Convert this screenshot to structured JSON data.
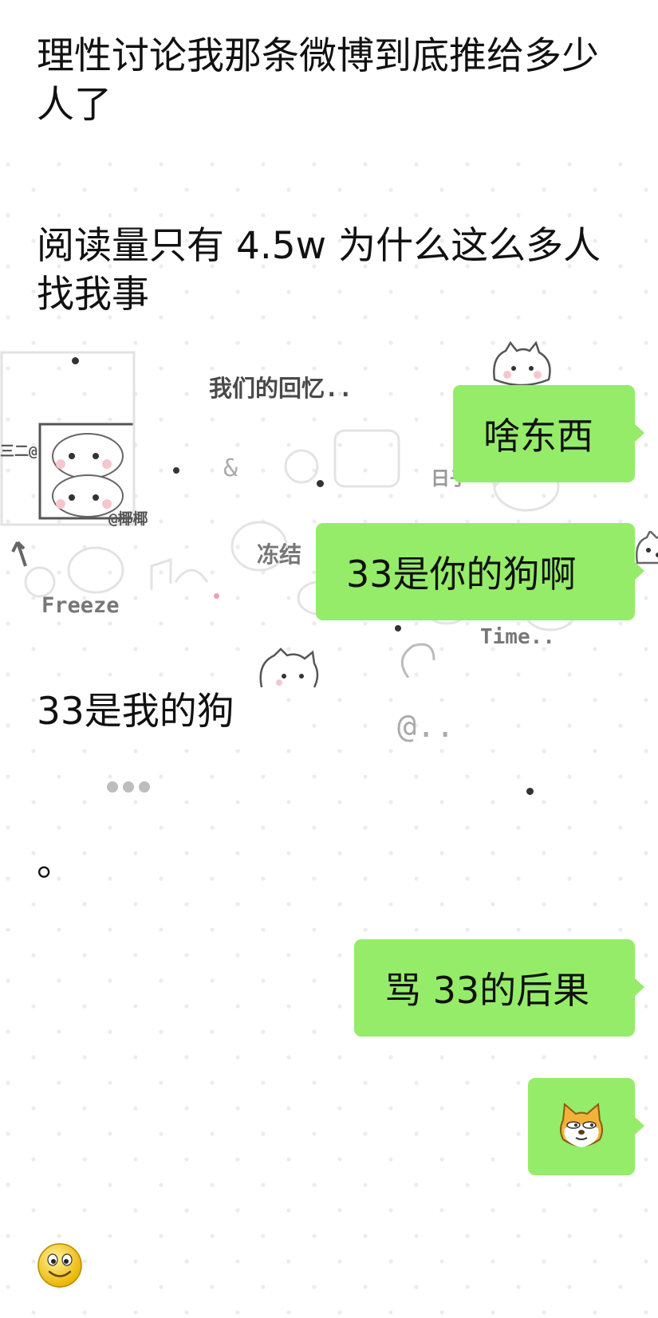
{
  "messages_left": [
    {
      "text": "理性讨论我那条微博到底推给多少人了"
    },
    {
      "text": "阅读量只有 4.5w 为什么这么多人找我事"
    },
    {
      "text": "33是我的狗"
    },
    {
      "text": "。"
    }
  ],
  "messages_right": [
    {
      "text": "啥东西"
    },
    {
      "text": "33是你的狗啊"
    },
    {
      "text": "骂 33的后果"
    },
    {
      "text": "",
      "sticker": "doge-cat-icon"
    }
  ],
  "last_left_sticker": "smiley-face-icon",
  "wallpaper": {
    "texts": [
      "我们的回忆..",
      "@椰椰",
      "三二@",
      "冻结",
      "Freeze",
      "Time..",
      "@..",
      "&",
      "日子"
    ],
    "colors": {
      "bubble": "#95ec69",
      "text": "#111111"
    }
  }
}
